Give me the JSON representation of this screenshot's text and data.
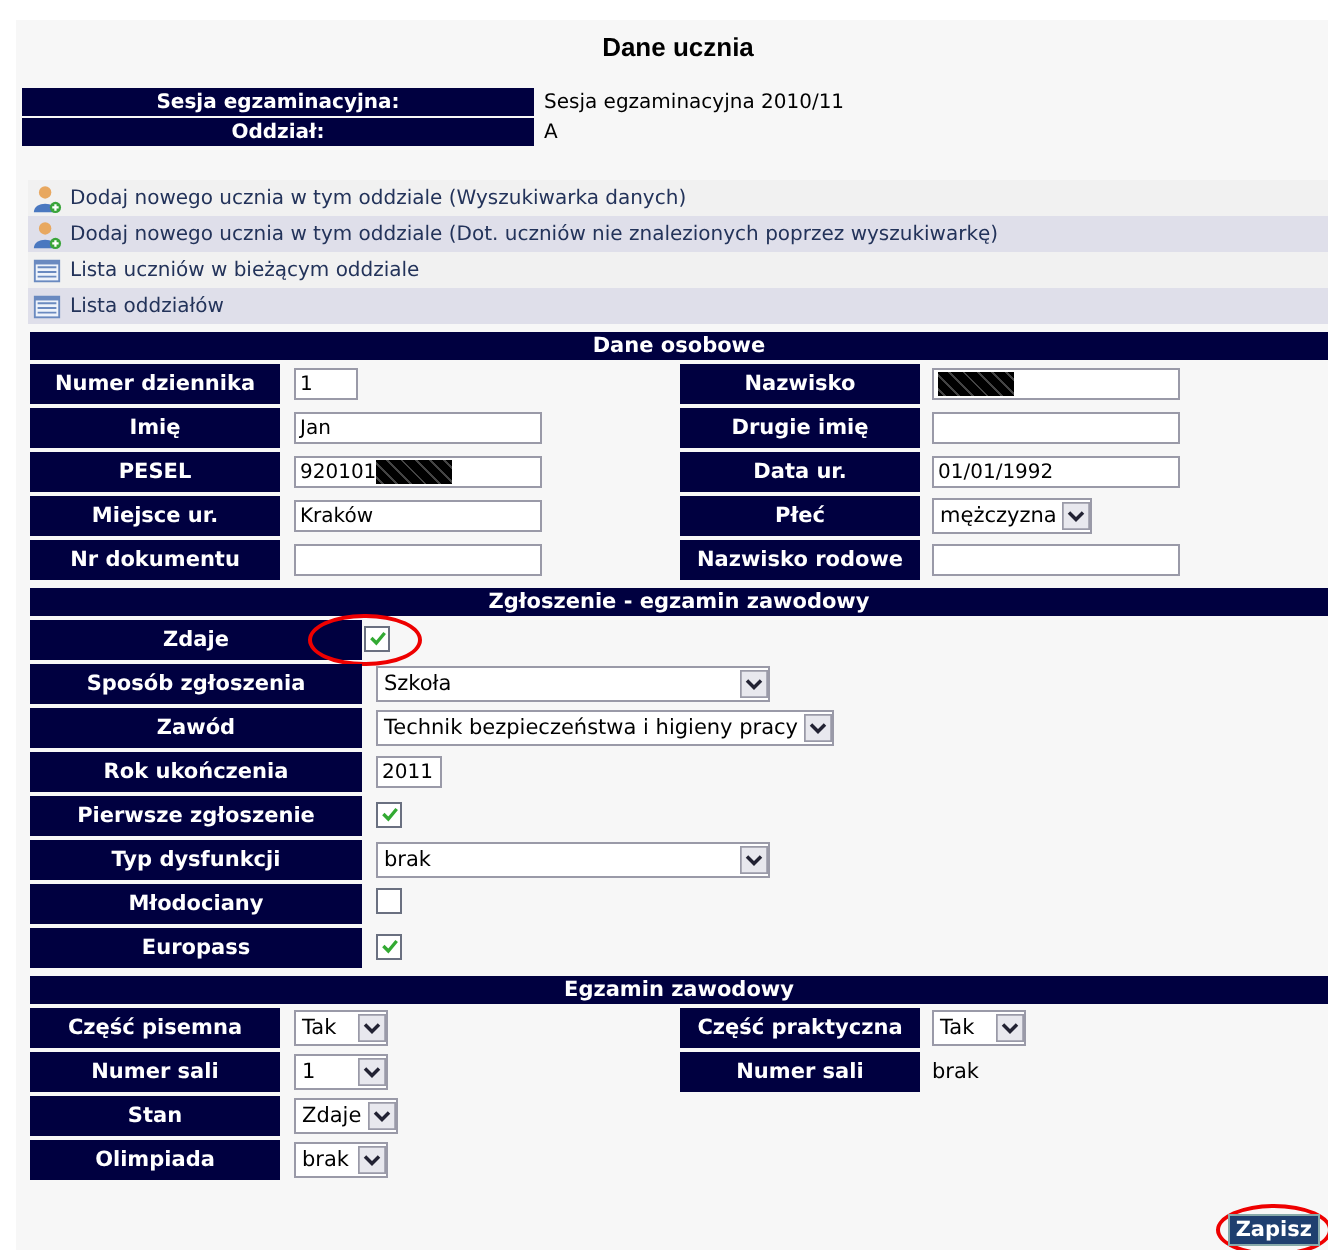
{
  "title": "Dane ucznia",
  "session": [
    {
      "label": "Sesja egzaminacyjna:",
      "value": "Sesja egzaminacyjna 2010/11"
    },
    {
      "label": "Oddział:",
      "value": "A"
    }
  ],
  "links": [
    {
      "label": "Dodaj nowego ucznia w tym oddziale (Wyszukiwarka danych)",
      "kind": "user-add"
    },
    {
      "label": "Dodaj nowego ucznia w tym oddziale (Dot. uczniów nie znalezionych poprzez wyszukiwarkę)",
      "kind": "user-add"
    },
    {
      "label": "Lista uczniów w bieżącym oddziale",
      "kind": "list"
    },
    {
      "label": "Lista oddziałów",
      "kind": "list"
    }
  ],
  "personal": {
    "title": "Dane osobowe",
    "rows": [
      [
        {
          "label": "Numer dziennika",
          "kind": "short-text",
          "value": "1"
        },
        {
          "label": "Nazwisko",
          "kind": "text",
          "redacted": true
        }
      ],
      [
        {
          "label": "Imię",
          "kind": "text",
          "value": "Jan"
        },
        {
          "label": "Drugie imię",
          "kind": "text"
        }
      ],
      [
        {
          "label": "PESEL",
          "kind": "text",
          "value": "920101",
          "redacted": true
        },
        {
          "label": "Data ur.",
          "kind": "text",
          "value": "01/01/1992"
        }
      ],
      [
        {
          "label": "Miejsce ur.",
          "kind": "text",
          "value": "Kraków"
        },
        {
          "label": "Płeć",
          "kind": "select",
          "value": "mężczyzna"
        }
      ],
      [
        {
          "label": "Nr dokumentu",
          "kind": "text"
        },
        {
          "label": "Nazwisko rodowe",
          "kind": "text"
        }
      ]
    ]
  },
  "application": {
    "title": "Zgłoszenie - egzamin zawodowy",
    "rows": [
      {
        "label": "Zdaje",
        "kind": "checkbox",
        "checked": true,
        "highlighted": true
      },
      {
        "label": "Sposób zgłoszenia",
        "kind": "long-select",
        "value": "Szkoła"
      },
      {
        "label": "Zawód",
        "kind": "select",
        "value": "Technik bezpieczeństwa i higieny pracy"
      },
      {
        "label": "Rok ukończenia",
        "kind": "short-text",
        "value": "2011"
      },
      {
        "label": "Pierwsze zgłoszenie",
        "kind": "checkbox",
        "checked": true,
        "highlighted": false
      },
      {
        "label": "Typ dysfunkcji",
        "kind": "long-select",
        "value": "brak"
      },
      {
        "label": "Młodociany",
        "kind": "checkbox",
        "checked": false,
        "highlighted": false
      },
      {
        "label": "Europass",
        "kind": "checkbox",
        "checked": true,
        "highlighted": false
      }
    ]
  },
  "exam": {
    "title": "Egzamin zawodowy",
    "rows": [
      [
        {
          "label": "Część pisemna",
          "kind": "select",
          "value": "Tak"
        },
        {
          "label": "Część praktyczna",
          "kind": "select",
          "value": "Tak"
        }
      ],
      [
        {
          "label": "Numer sali",
          "kind": "select",
          "value": "1"
        },
        {
          "label": "Numer sali",
          "kind": "plain",
          "value": "brak"
        }
      ],
      [
        {
          "label": "Stan",
          "kind": "select",
          "value": "Zdaje"
        }
      ],
      [
        {
          "label": "Olimpiada",
          "kind": "select",
          "value": "brak"
        }
      ]
    ]
  },
  "save_button": {
    "label": "Zapisz",
    "highlighted": true
  }
}
